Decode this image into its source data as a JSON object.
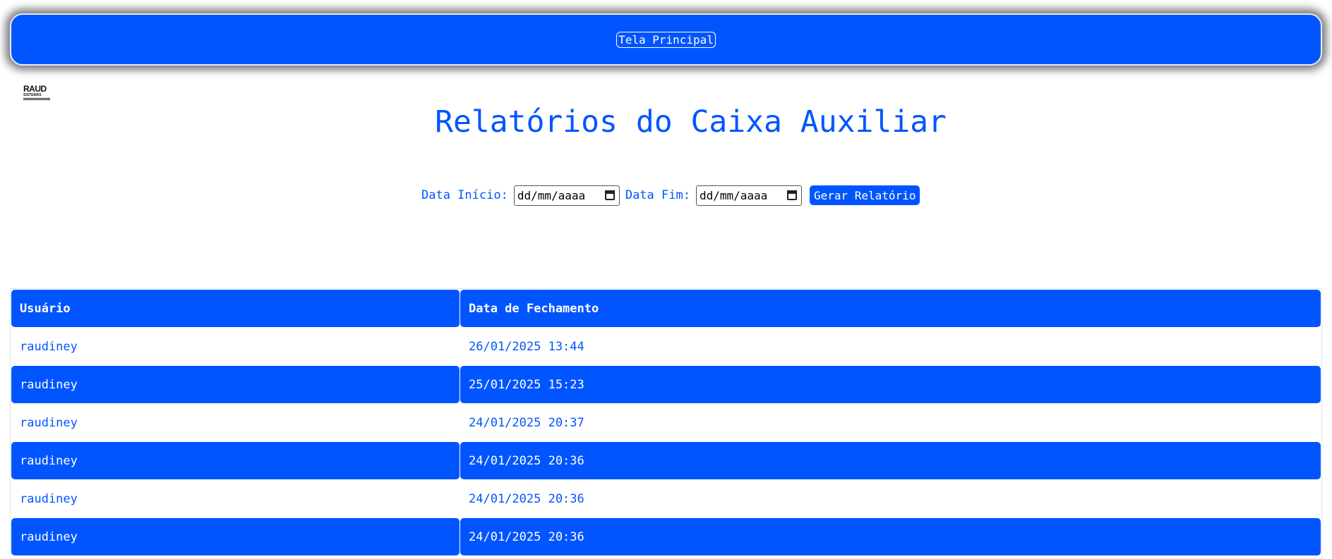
{
  "nav": {
    "home_link": "Tela Principal"
  },
  "logo": {
    "line1": "RAUD",
    "line2": "SISTEMAS"
  },
  "page": {
    "title": "Relatórios do Caixa Auxiliar"
  },
  "filters": {
    "start_label": "Data Início:",
    "start_value": "dd/mm/aaaa",
    "end_label": "Data Fim:",
    "end_value": "dd/mm/aaaa",
    "generate_button": "Gerar Relatório"
  },
  "table": {
    "headers": [
      "Usuário",
      "Data de Fechamento"
    ],
    "rows": [
      {
        "user": "raudiney",
        "date": "26/01/2025 13:44"
      },
      {
        "user": "raudiney",
        "date": "25/01/2025 15:23"
      },
      {
        "user": "raudiney",
        "date": "24/01/2025 20:37"
      },
      {
        "user": "raudiney",
        "date": "24/01/2025 20:36"
      },
      {
        "user": "raudiney",
        "date": "24/01/2025 20:36"
      },
      {
        "user": "raudiney",
        "date": "24/01/2025 20:36"
      }
    ]
  },
  "colors": {
    "primary": "#0055ff",
    "background": "#ffffff"
  }
}
